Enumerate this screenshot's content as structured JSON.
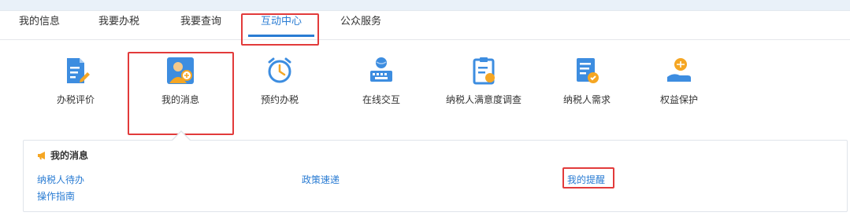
{
  "tabs": [
    {
      "label": "我的信息",
      "active": false
    },
    {
      "label": "我要办税",
      "active": false
    },
    {
      "label": "我要查询",
      "active": false
    },
    {
      "label": "互动中心",
      "active": true
    },
    {
      "label": "公众服务",
      "active": false
    }
  ],
  "icons": [
    {
      "label": "办税评价",
      "icon": "pencil-document-icon"
    },
    {
      "label": "我的消息",
      "icon": "user-message-icon"
    },
    {
      "label": "预约办税",
      "icon": "alarm-clock-icon"
    },
    {
      "label": "在线交互",
      "icon": "globe-keyboard-icon"
    },
    {
      "label": "纳税人满意度调查",
      "icon": "clipboard-survey-icon"
    },
    {
      "label": "纳税人需求",
      "icon": "document-needs-icon"
    },
    {
      "label": "权益保护",
      "icon": "hand-coin-icon"
    }
  ],
  "message_panel": {
    "title": "我的消息",
    "links": [
      {
        "label": "纳税人待办"
      },
      {
        "label": "政策速递"
      },
      {
        "label": "我的提醒"
      },
      {
        "label": "操作指南"
      }
    ]
  },
  "colors": {
    "accent": "#2a7cd3",
    "highlight": "#e23b3b",
    "icon_orange": "#f5a623"
  }
}
